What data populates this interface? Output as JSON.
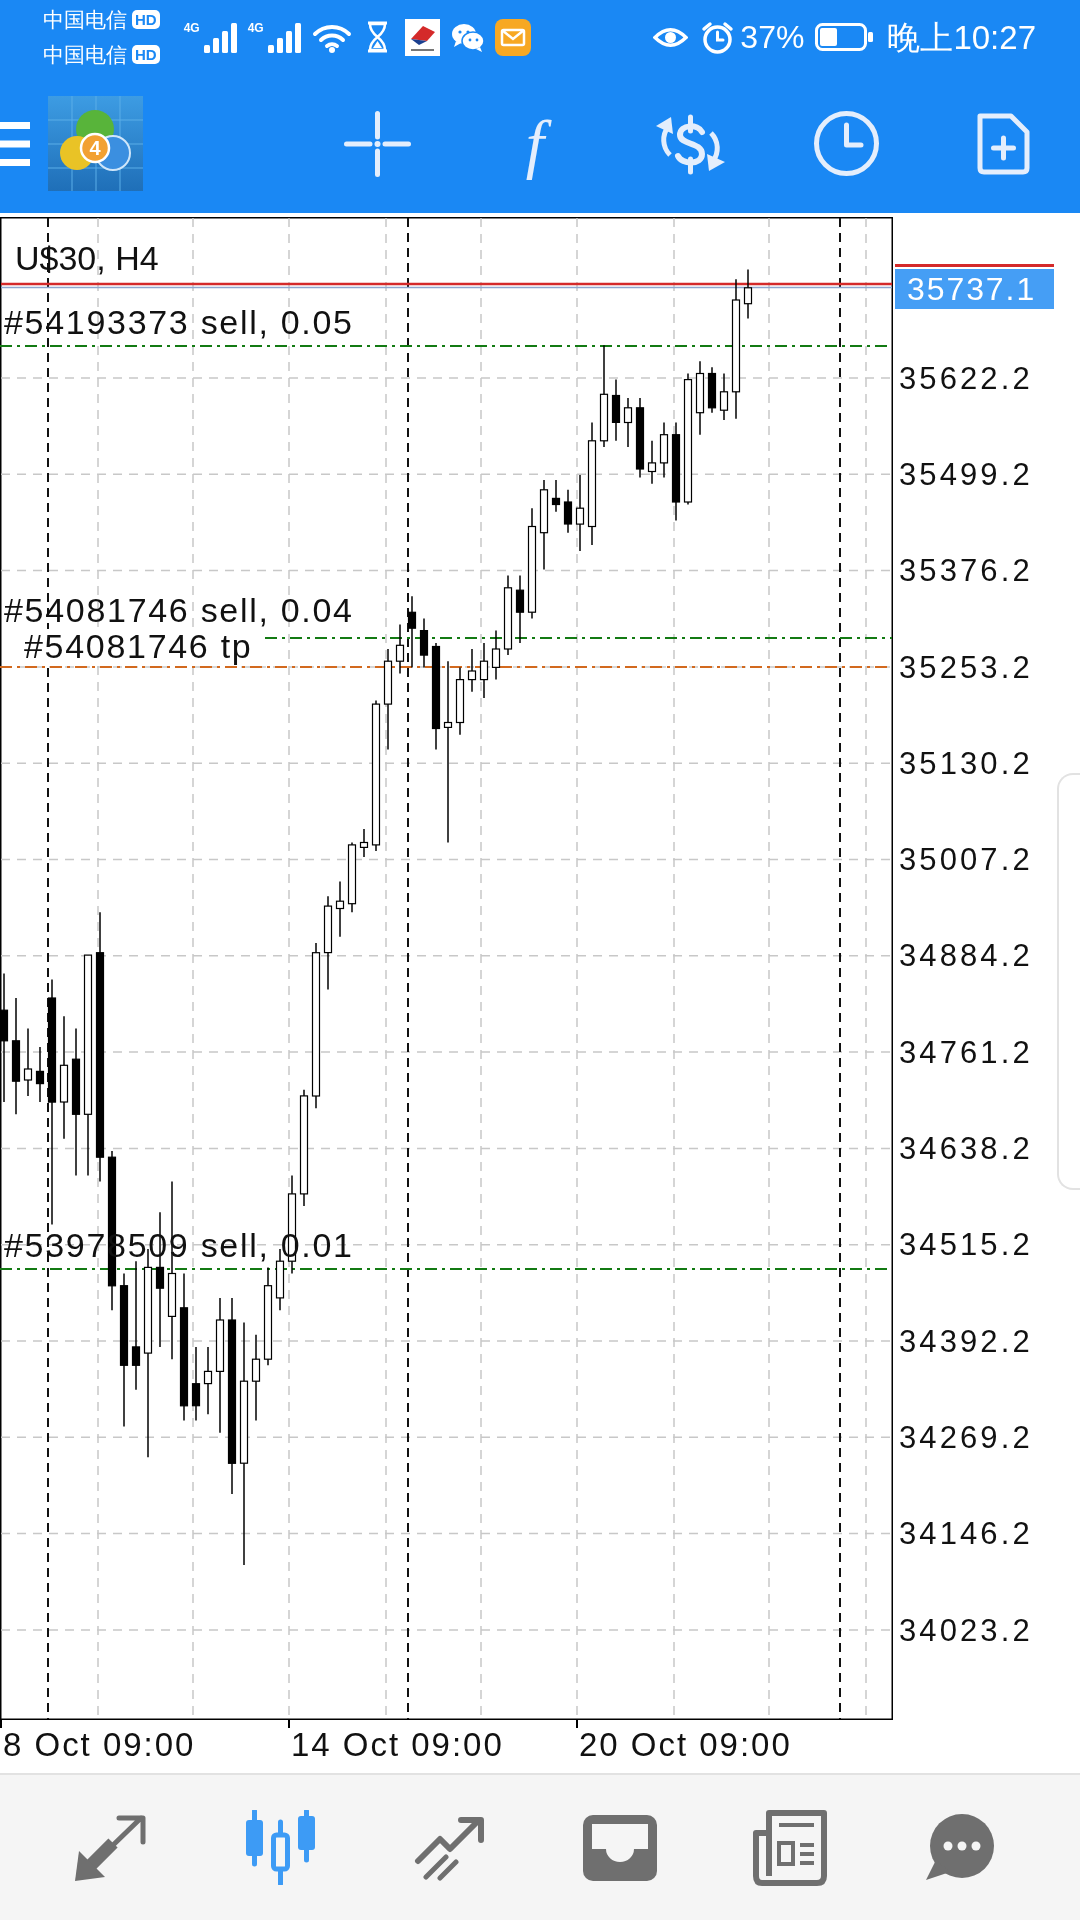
{
  "status_bar": {
    "sims": [
      {
        "carrier": "中国电信",
        "badge": "HD",
        "network": "4G"
      },
      {
        "carrier": "中国电信",
        "badge": "HD",
        "network": "4G"
      }
    ],
    "battery": "37%",
    "time": "晚上10:27"
  },
  "toolbar": {
    "logo_badge": "4",
    "function_glyph": "f"
  },
  "chart": {
    "symbol": "U$30, H4",
    "current_price": "35737.1",
    "trade_lines": [
      {
        "kind": "order",
        "label": "#54193373 sell, 0.05"
      },
      {
        "kind": "order",
        "label": "#54081746 sell, 0.04"
      },
      {
        "kind": "take_profit",
        "label": "#54081746 tp"
      },
      {
        "kind": "order",
        "label": "#53978509 sell, 0.01"
      }
    ],
    "price_labels": [
      "35622.2",
      "35499.2",
      "35376.2",
      "35253.2",
      "35130.2",
      "35007.2",
      "34884.2",
      "34761.2",
      "34638.2",
      "34515.2",
      "34392.2",
      "34269.2",
      "34146.2",
      "34023.2"
    ],
    "time_labels": [
      "8 Oct 09:00",
      "14 Oct 09:00",
      "20 Oct 09:00"
    ]
  },
  "bottom_nav": [
    {
      "selected": false
    },
    {
      "selected": true
    },
    {
      "selected": false
    },
    {
      "selected": false
    },
    {
      "selected": false
    },
    {
      "selected": false
    }
  ]
}
